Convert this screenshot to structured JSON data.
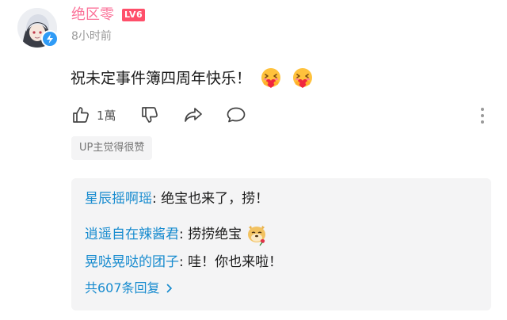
{
  "comment": {
    "username": "绝区零",
    "level_badge": "LV6",
    "time": "8小时前",
    "text": "祝未定事件簿四周年快乐！",
    "emojis": [
      "hug-heart-emoji",
      "hug-heart-emoji"
    ],
    "like_count": "1萬",
    "up_liked_tag": "UP主觉得很赞"
  },
  "replies": [
    {
      "user": "星辰摇啊瑶",
      "text": ": 绝宝也来了，捞！"
    },
    {
      "user": "逍遥自在辣酱君",
      "text": ": 捞捞绝宝",
      "emoji": "doge-rose-emoji"
    },
    {
      "user": "晃哒晃哒的团子",
      "text": ": 哇！你也来啦！"
    }
  ],
  "reply_count_label": "共607条回复",
  "colors": {
    "username": "#fb7299",
    "level_badge": "#ff4f6a",
    "reply_user": "#178bcf",
    "reply_box_bg": "#f4f4f5"
  }
}
